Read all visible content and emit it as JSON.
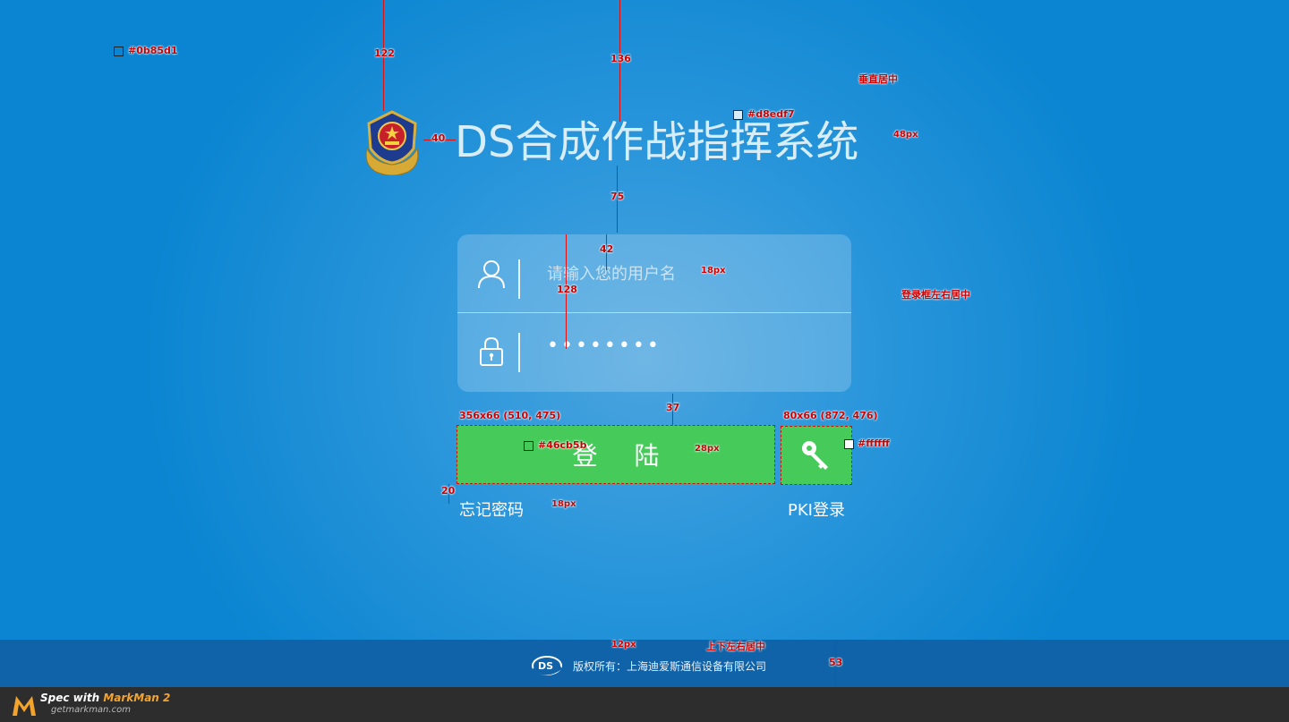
{
  "header": {
    "title": "DS合成作战指挥系统",
    "emblem_icon": "police-emblem-icon",
    "title_color": "#d8edf7"
  },
  "login": {
    "username_placeholder": "请输入您的用户名",
    "password_value": "12345678",
    "user_icon": "user-icon",
    "lock_icon": "lock-icon",
    "login_button_label": "登 陆",
    "pki_button_icon": "key-icon",
    "forgot_password_label": "忘记密码",
    "pki_login_label": "PKI登录",
    "button_color": "#46cb5b"
  },
  "footer": {
    "copyright": "版权所有：上海迪爱斯通信设备有限公司",
    "logo_icon": "ds-logo-icon"
  },
  "spec_bar": {
    "line1_prefix": "Spec with ",
    "line1_brand": "MarkMan 2",
    "line2": "getmarkman.com"
  },
  "annotations": {
    "bg_color": "#0b85d1",
    "title_color": "#d8edf7",
    "vertical_center": "垂直居中",
    "title_size": "48px",
    "d_122": "122",
    "d_136": "136",
    "d_40": "40",
    "d_75": "75",
    "d_42": "42",
    "d_128": "128",
    "input_size": "18px",
    "box_center": "登录框左右居中",
    "d_37": "37",
    "login_btn_dim": "356x66 (510, 475)",
    "pki_btn_dim": "80x66 (872, 476)",
    "btn_color": "#46cb5b",
    "btn_text_size": "28px",
    "white_color": "#ffffff",
    "d_20": "20",
    "link_size": "18px",
    "footer_size": "12px",
    "footer_center": "上下左右居中",
    "d_53": "53"
  }
}
